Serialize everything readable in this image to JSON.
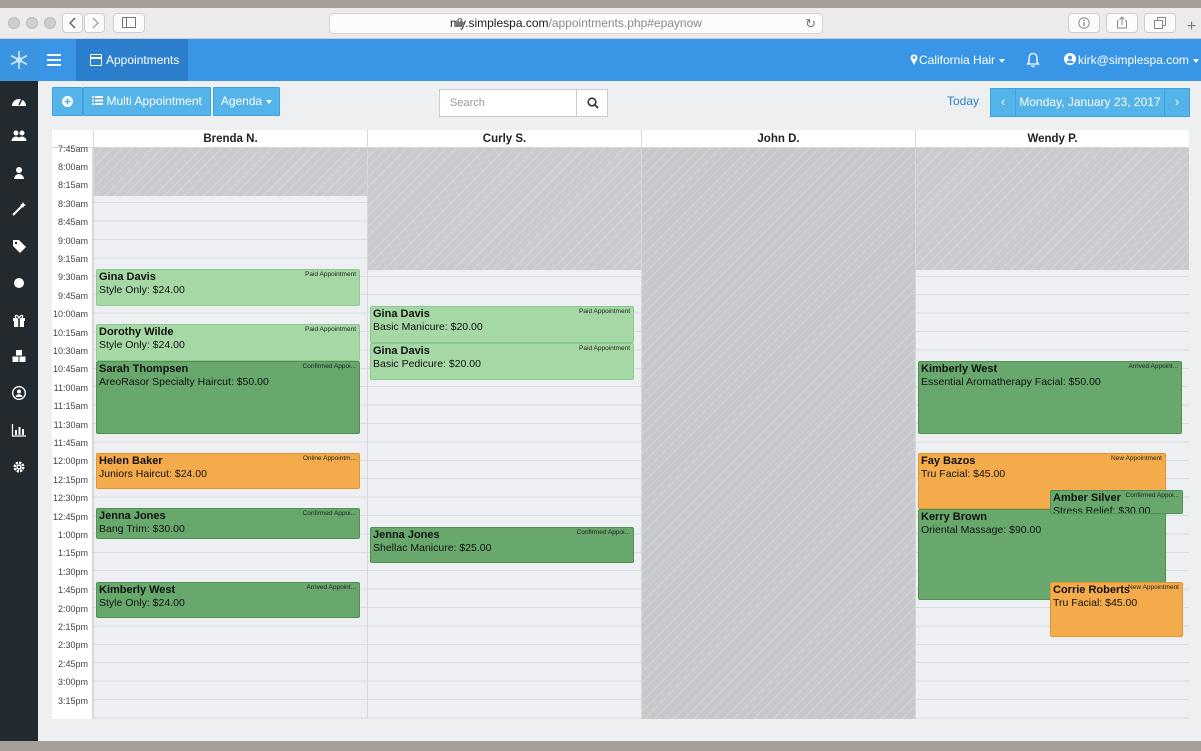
{
  "browser": {
    "url_host": "my.simplespa.com",
    "url_path": "/appointments.php#epaynow"
  },
  "nav": {
    "tab_label": "Appointments",
    "location": "California Hair",
    "user": "kirk@simplespa.com"
  },
  "toolbar": {
    "multi_label": "Multi Appointment",
    "agenda_label": "Agenda",
    "search_placeholder": "Search",
    "today_label": "Today",
    "date_label": "Monday, January 23, 2017"
  },
  "staff": [
    "Brenda N.",
    "Curly S.",
    "John D.",
    "Wendy P."
  ],
  "time_slots": [
    "7:45am",
    "8:00am",
    "8:15am",
    "8:30am",
    "8:45am",
    "9:00am",
    "9:15am",
    "9:30am",
    "9:45am",
    "10:00am",
    "10:15am",
    "10:30am",
    "10:45am",
    "11:00am",
    "11:15am",
    "11:30am",
    "11:45am",
    "12:00pm",
    "12:15pm",
    "12:30pm",
    "12:45pm",
    "1:00pm",
    "1:15pm",
    "1:30pm",
    "1:45pm",
    "2:00pm",
    "2:15pm",
    "2:30pm",
    "2:45pm",
    "3:00pm",
    "3:15pm"
  ],
  "appointments": [
    {
      "staff": 0,
      "client": "Gina Davis",
      "service": "Style Only: $24.00",
      "status": "Paid Appointment",
      "kind": "paid"
    },
    {
      "staff": 0,
      "client": "Dorothy Wilde",
      "service": "Style Only: $24.00",
      "status": "Paid Appointment",
      "kind": "paid"
    },
    {
      "staff": 0,
      "client": "Sarah Thompsen",
      "service": "AreoRasor Specialty Haircut: $50.00",
      "status": "Confirmed Appoi...",
      "kind": "green"
    },
    {
      "staff": 0,
      "client": "Helen Baker",
      "service": "Juniors Haircut: $24.00",
      "status": "Online Appointm...",
      "kind": "orange"
    },
    {
      "staff": 0,
      "client": "Jenna Jones",
      "service": "Bang Trim: $30.00",
      "status": "Confirmed Appoi...",
      "kind": "green"
    },
    {
      "staff": 0,
      "client": "Kimberly West",
      "service": "Style Only: $24.00",
      "status": "Arrived Appoint...",
      "kind": "green"
    },
    {
      "staff": 1,
      "client": "Gina Davis",
      "service": "Basic Manicure: $20.00",
      "status": "Paid Appointment",
      "kind": "paid"
    },
    {
      "staff": 1,
      "client": "Gina Davis",
      "service": "Basic Pedicure: $20.00",
      "status": "Paid Appointment",
      "kind": "paid"
    },
    {
      "staff": 1,
      "client": "Jenna Jones",
      "service": "Shellac Manicure: $25.00",
      "status": "Confirmed Appoi...",
      "kind": "green"
    },
    {
      "staff": 3,
      "client": "Kimberly West",
      "service": "Essential Aromatherapy Facial: $50.00",
      "status": "Arrived Appoint...",
      "kind": "green"
    },
    {
      "staff": 3,
      "client": "Fay Bazos",
      "service": "Tru Facial: $45.00",
      "status": "New Appointment",
      "kind": "orange"
    },
    {
      "staff": 3,
      "client": "Kerry Brown",
      "service": "Oriental Massage: $90.00",
      "status": "",
      "kind": "green"
    },
    {
      "staff": 3,
      "client": "Amber Silver",
      "service": "Stress Relief: $30.00",
      "status": "Confirmed Appoi...",
      "kind": "green"
    },
    {
      "staff": 3,
      "client": "Corrie Roberts",
      "service": "Tru Facial: $45.00",
      "status": "New Appointment",
      "kind": "orange"
    }
  ],
  "colors": {
    "nav_blue": "#3996e6",
    "button_blue": "#54b3e8",
    "sidebar": "#22292f",
    "paid": "#a6d8a6",
    "confirmed": "#68a86d",
    "new_online": "#f4ab4c",
    "blocked": "#c9cbce"
  }
}
